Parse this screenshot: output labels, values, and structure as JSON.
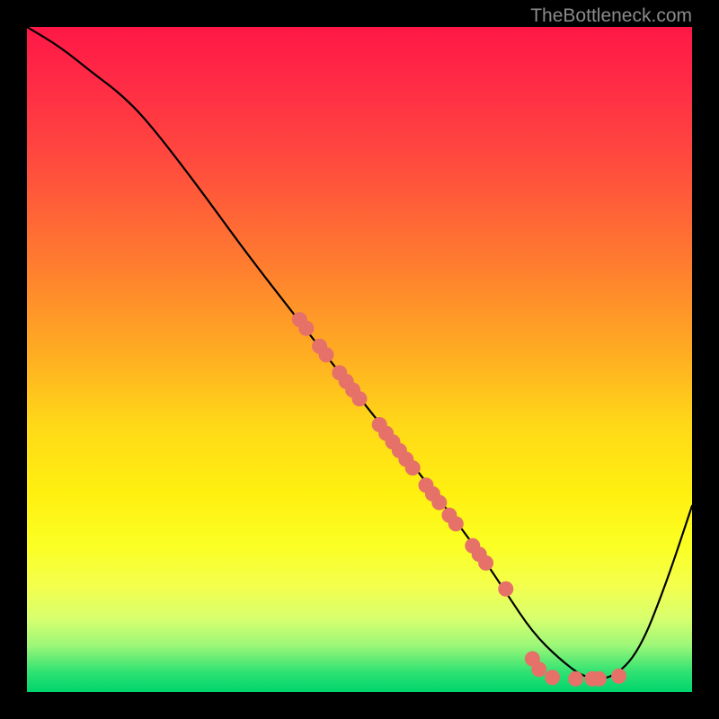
{
  "watermark": "TheBottleneck.com",
  "chart_data": {
    "type": "line",
    "title": "",
    "xlabel": "",
    "ylabel": "",
    "xlim": [
      0,
      100
    ],
    "ylim": [
      0,
      100
    ],
    "series": [
      {
        "name": "curve",
        "x": [
          0,
          5,
          10,
          14,
          18,
          25,
          33,
          40,
          47,
          55,
          62,
          68,
          72,
          76,
          80,
          84,
          88,
          92,
          96,
          100
        ],
        "y": [
          100,
          97,
          93,
          90,
          86,
          77,
          66,
          57,
          48,
          38,
          29,
          21,
          15,
          9,
          5,
          2,
          2,
          6,
          16,
          28
        ]
      }
    ],
    "markers": [
      {
        "x": 41,
        "y": 56
      },
      {
        "x": 42,
        "y": 54.7
      },
      {
        "x": 44,
        "y": 52
      },
      {
        "x": 45,
        "y": 50.7
      },
      {
        "x": 47,
        "y": 48
      },
      {
        "x": 48,
        "y": 46.7
      },
      {
        "x": 49,
        "y": 45.4
      },
      {
        "x": 50,
        "y": 44.1
      },
      {
        "x": 53,
        "y": 40.2
      },
      {
        "x": 54,
        "y": 38.9
      },
      {
        "x": 55,
        "y": 37.6
      },
      {
        "x": 56,
        "y": 36.3
      },
      {
        "x": 57,
        "y": 35.0
      },
      {
        "x": 58,
        "y": 33.7
      },
      {
        "x": 60,
        "y": 31.1
      },
      {
        "x": 61,
        "y": 29.8
      },
      {
        "x": 62,
        "y": 28.5
      },
      {
        "x": 63.5,
        "y": 26.6
      },
      {
        "x": 64.5,
        "y": 25.3
      },
      {
        "x": 67,
        "y": 22.0
      },
      {
        "x": 68,
        "y": 20.7
      },
      {
        "x": 69,
        "y": 19.4
      },
      {
        "x": 72,
        "y": 15.5
      },
      {
        "x": 76,
        "y": 5.0
      },
      {
        "x": 77,
        "y": 3.4
      },
      {
        "x": 79,
        "y": 2.2
      },
      {
        "x": 82.5,
        "y": 2.0
      },
      {
        "x": 85,
        "y": 2.0
      },
      {
        "x": 86,
        "y": 2.0
      },
      {
        "x": 89,
        "y": 2.4
      }
    ],
    "colors": {
      "curve": "#000000",
      "marker_fill": "#e57168",
      "marker_stroke": "#e57168"
    }
  }
}
